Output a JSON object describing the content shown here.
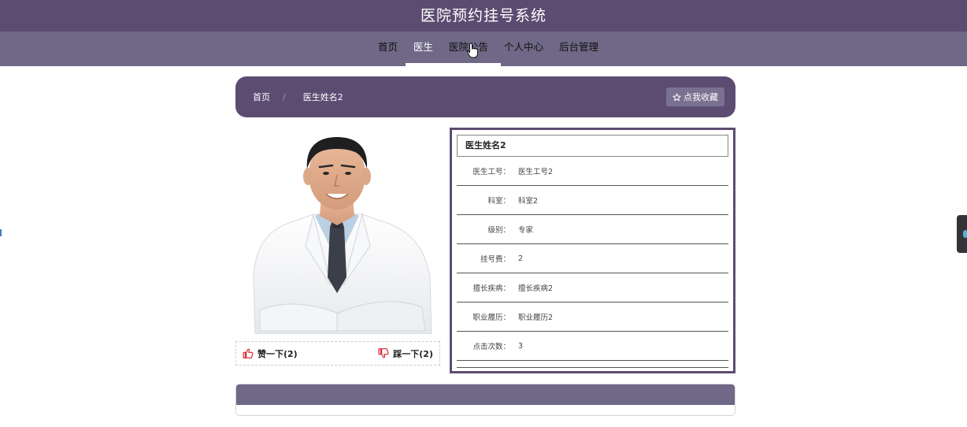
{
  "site": {
    "title": "医院预约挂号系统"
  },
  "nav": {
    "items": [
      {
        "label": "首页"
      },
      {
        "label": "医生"
      },
      {
        "label": "医院公告"
      },
      {
        "label": "个人中心"
      },
      {
        "label": "后台管理"
      }
    ],
    "active_index": 1
  },
  "breadcrumb": {
    "home": "首页",
    "separator": "/",
    "current": "医生姓名2"
  },
  "favorite": {
    "icon": "star-outline-icon",
    "label": "点我收藏"
  },
  "doctor": {
    "name": "医生姓名2",
    "fields": [
      {
        "label": "医生工号：",
        "value": "医生工号2"
      },
      {
        "label": "科室：",
        "value": "科室2"
      },
      {
        "label": "级别：",
        "value": "专家"
      },
      {
        "label": "挂号费：",
        "value": "2"
      },
      {
        "label": "擅长疾病：",
        "value": "擅长疾病2"
      },
      {
        "label": "职业履历：",
        "value": "职业履历2"
      },
      {
        "label": "点击次数：",
        "value": "3"
      }
    ]
  },
  "votes": {
    "like": {
      "icon": "thumbs-up-icon",
      "label": "赞一下(2)"
    },
    "dislike": {
      "icon": "thumbs-down-icon",
      "label": "踩一下(2)"
    }
  },
  "colors": {
    "primary": "#5c4c72",
    "nav": "#6f6886",
    "accent_red": "#d9232d"
  }
}
